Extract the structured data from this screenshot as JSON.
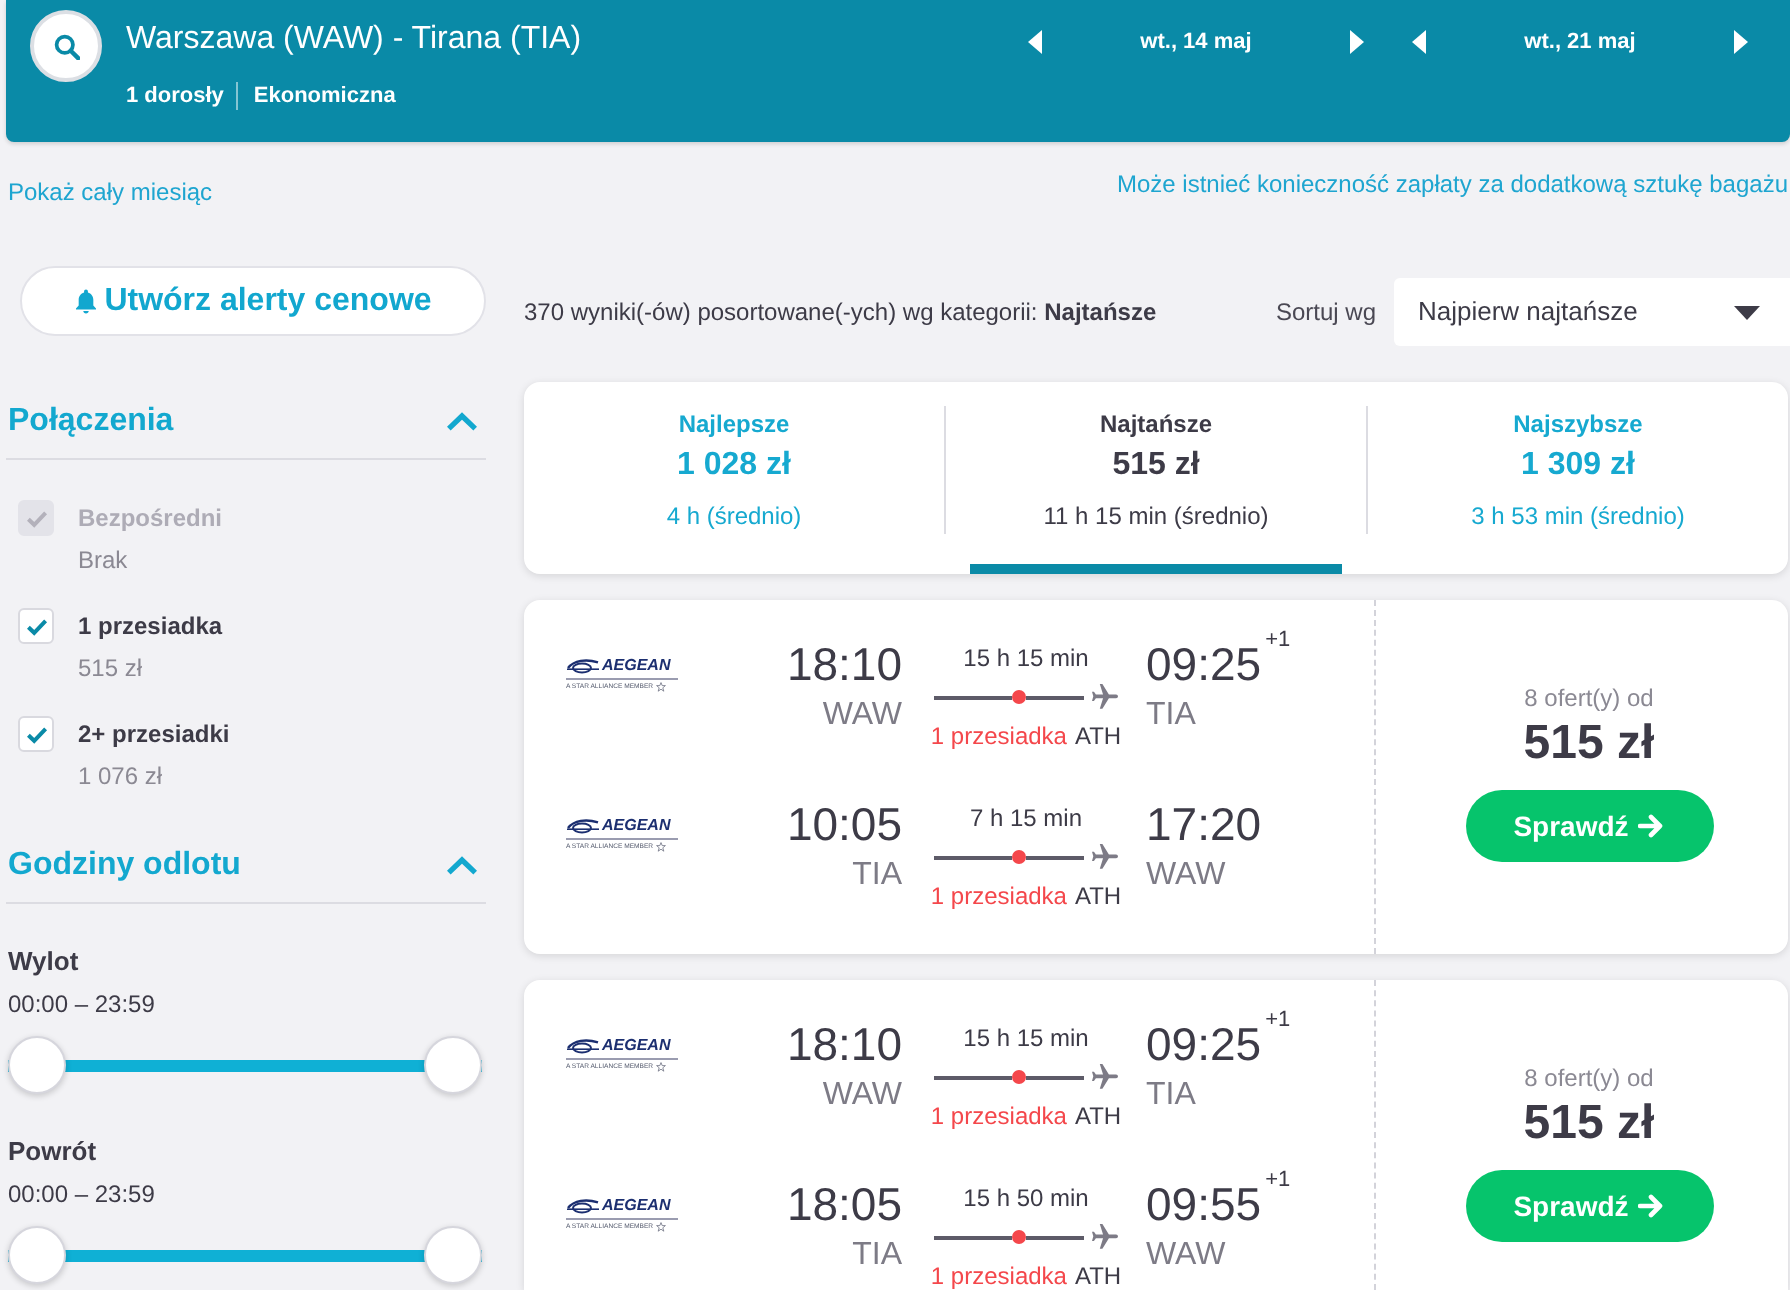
{
  "search_bar": {
    "route": "Warszawa (WAW) - Tirana (TIA)",
    "passengers": "1 dorosły",
    "cabin": "Ekonomiczna",
    "dates": [
      {
        "label": "wt., 14 maj"
      },
      {
        "label": "wt., 21 maj"
      }
    ]
  },
  "links": {
    "calendar": "Pokaż cały miesiąc",
    "baggage_notice": "Może istnieć konieczność zapłaty za dodatkową sztukę bagażu"
  },
  "sidebar": {
    "alert_button": "Utwórz alerty cenowe",
    "filters": [
      {
        "kind": "checkboxes",
        "title": "Połączenia",
        "expanded": true,
        "options": [
          {
            "label": "Bezpośredni",
            "price": "Brak",
            "checked": true,
            "disabled": true
          },
          {
            "label": "1 przesiadka",
            "price": "515 zł",
            "checked": true,
            "disabled": false
          },
          {
            "label": "2+ przesiadki",
            "price": "1 076 zł",
            "checked": true,
            "disabled": false
          }
        ]
      },
      {
        "kind": "sliders",
        "title": "Godziny odlotu",
        "expanded": true,
        "sliders": [
          {
            "label": "Wylot",
            "range": "00:00 – 23:59",
            "level": 1
          },
          {
            "label": "Powrót",
            "range": "00:00 – 23:59",
            "level": 1
          }
        ]
      }
    ]
  },
  "results": {
    "summary": "370 wyniki(-ów) posortowane(-ych) wg kategorii: **Najtańsze**",
    "sort": {
      "label": "Sortuj wg",
      "value": "Najpierw najtańsze"
    },
    "tabs": [
      {
        "title": "Najlepsze",
        "price": "1 028 zł",
        "duration": "4 h (średnio)",
        "selected": false
      },
      {
        "title": "Najtańsze",
        "price": "515 zł",
        "duration": "11 h 15 min (średnio)",
        "selected": true
      },
      {
        "title": "Najszybsze",
        "price": "1 309 zł",
        "duration": "3 h 53 min (średnio)",
        "selected": false
      }
    ],
    "flights": [
      {
        "legs": [
          {
            "airline": "AEGEAN",
            "airline_tagline": "A STAR ALLIANCE MEMBER",
            "departure_time": "18:10",
            "departure_airport": "WAW",
            "duration": "15 h 15 min",
            "stops": "1 przesiadka",
            "stop_airport": "ATH",
            "arrival_time": "09:25",
            "day_offset": "+1",
            "arrival_airport": "TIA"
          },
          {
            "airline": "AEGEAN",
            "airline_tagline": "A STAR ALLIANCE MEMBER",
            "departure_time": "10:05",
            "departure_airport": "TIA",
            "duration": "7 h 15 min",
            "stops": "1 przesiadka",
            "stop_airport": "ATH",
            "arrival_time": "17:20",
            "arrival_airport": "WAW"
          }
        ],
        "offers": "8 ofert(y) od",
        "price": "515 zł",
        "button": "Sprawdź"
      },
      {
        "legs": [
          {
            "airline": "AEGEAN",
            "airline_tagline": "A STAR ALLIANCE MEMBER",
            "departure_time": "18:10",
            "departure_airport": "WAW",
            "duration": "15 h 15 min",
            "stops": "1 przesiadka",
            "stop_airport": "ATH",
            "arrival_time": "09:25",
            "day_offset": "+1",
            "arrival_airport": "TIA"
          },
          {
            "airline": "AEGEAN",
            "airline_tagline": "A STAR ALLIANCE MEMBER",
            "departure_time": "18:05",
            "departure_airport": "TIA",
            "duration": "15 h 50 min",
            "stops": "1 przesiadka",
            "stop_airport": "ATH",
            "arrival_time": "09:55",
            "day_offset": "+1",
            "arrival_airport": "WAW"
          }
        ],
        "offers": "8 ofert(y) od",
        "price": "515 zł",
        "button": "Sprawdź"
      }
    ]
  }
}
